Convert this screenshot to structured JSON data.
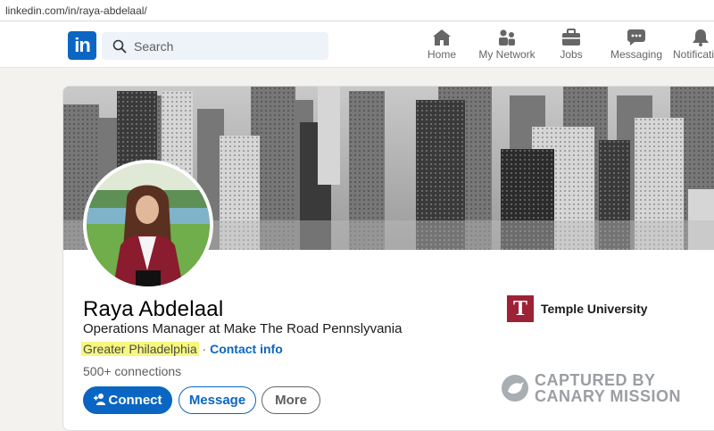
{
  "browser": {
    "url": "linkedin.com/in/raya-abdelaal/"
  },
  "nav": {
    "logo": "in",
    "search_placeholder": "Search",
    "items": [
      {
        "label": "Home",
        "icon": "home-icon"
      },
      {
        "label": "My Network",
        "icon": "people-icon"
      },
      {
        "label": "Jobs",
        "icon": "briefcase-icon"
      },
      {
        "label": "Messaging",
        "icon": "chat-icon"
      },
      {
        "label": "Notificatio",
        "icon": "bell-icon"
      }
    ]
  },
  "profile": {
    "name": "Raya Abdelaal",
    "headline": "Operations Manager at Make The Road Pennslyvania",
    "location": "Greater Philadelphia",
    "separator": " · ",
    "contact_link": "Contact info",
    "connections": "500+ connections",
    "buttons": {
      "connect": "Connect",
      "message": "Message",
      "more": "More"
    },
    "education": {
      "logo_letter": "T",
      "name": "Temple University"
    }
  },
  "watermark": {
    "line1": "CAPTURED BY",
    "line2": "CANARY MISSION"
  },
  "colors": {
    "accent": "#0a66c2",
    "highlight": "#f6f77f",
    "temple": "#9d2235"
  }
}
